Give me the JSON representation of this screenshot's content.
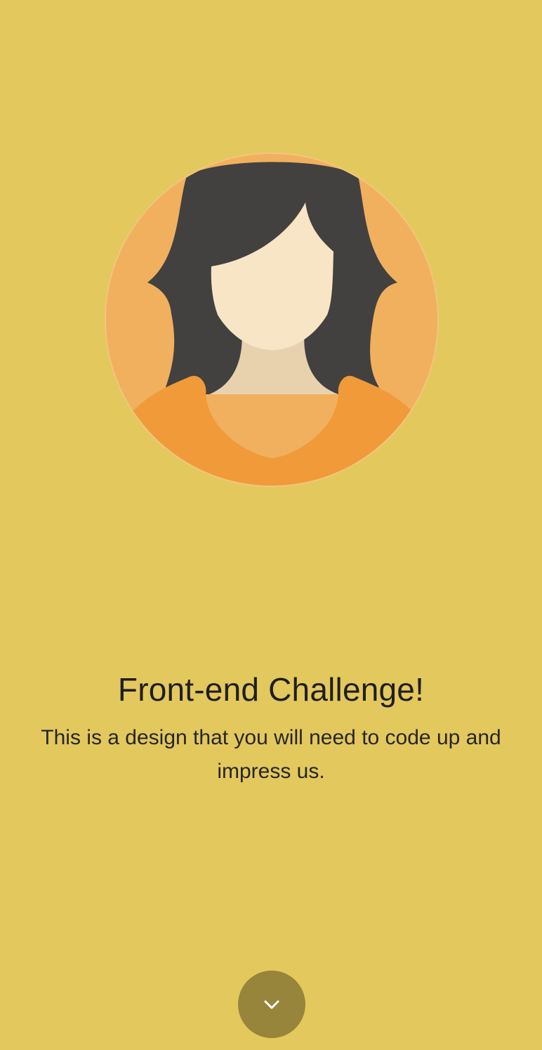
{
  "hero": {
    "title": "Front-end Challenge!",
    "subtitle": "This is a design that you will need to code up and impress us."
  },
  "avatar": {
    "icon": "woman-avatar-icon"
  },
  "scroll_button": {
    "icon": "chevron-down-icon"
  },
  "colors": {
    "background": "#E3C85E",
    "avatar_circle": "#F1B05E",
    "hair": "#424140",
    "skin": "#F8E5C5",
    "neck": "#E8D2AE",
    "shirt": "#F19A39",
    "button": "#96853B",
    "text": "#1F1F1F"
  }
}
